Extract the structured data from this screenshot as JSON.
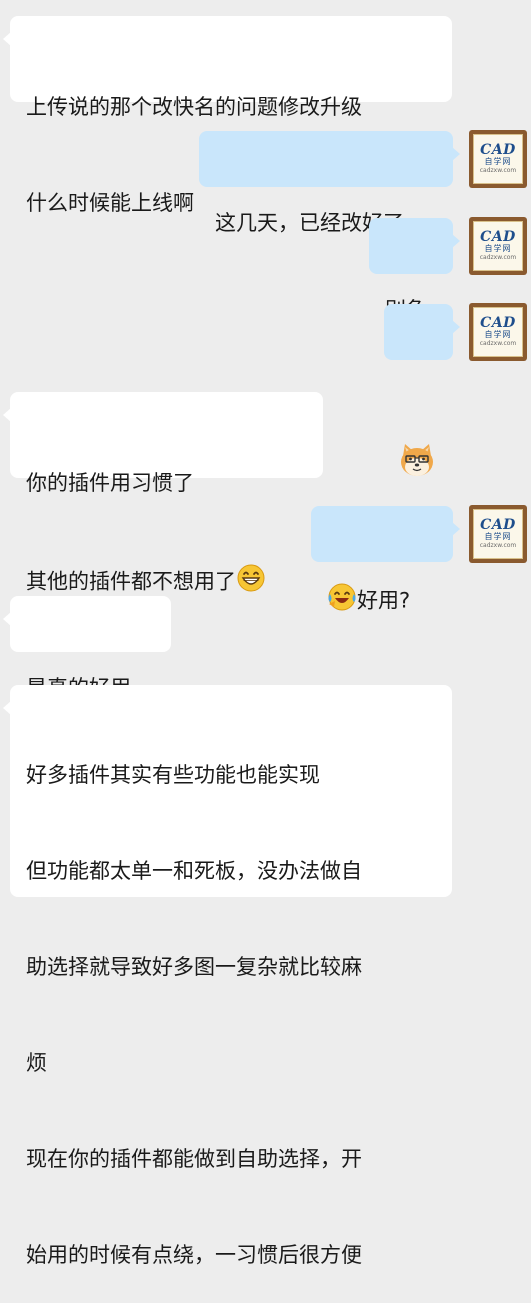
{
  "avatar": {
    "logo_main": "CAD",
    "logo_cn": "自学网",
    "logo_url": "cadzxw.com"
  },
  "messages": [
    {
      "from": "other",
      "lines": [
        "上传说的那个改快名的问题修改升级",
        "什么时候能上线啊"
      ]
    },
    {
      "from": "me",
      "text": "这几天，已经改好了"
    },
    {
      "from": "me",
      "text": "别急"
    },
    {
      "from": "me",
      "sticker": "shiba-dog-emoji"
    },
    {
      "from": "other",
      "lines": [
        "你的插件用习惯了",
        "其他的插件都不想用了"
      ],
      "trailing_emoji": "grin-emoji"
    },
    {
      "from": "me",
      "leading_emoji": "laugh-cry-emoji",
      "text": "好用?"
    },
    {
      "from": "other",
      "text": "是真的好用"
    },
    {
      "from": "other",
      "lines": [
        "好多插件其实有些功能也能实现",
        "但功能都太单一和死板，没办法做自",
        "助选择就导致好多图一复杂就比较麻",
        "烦",
        "现在你的插件都能做到自助选择，开",
        "始用的时候有点绕，一习惯后很方便"
      ]
    }
  ]
}
